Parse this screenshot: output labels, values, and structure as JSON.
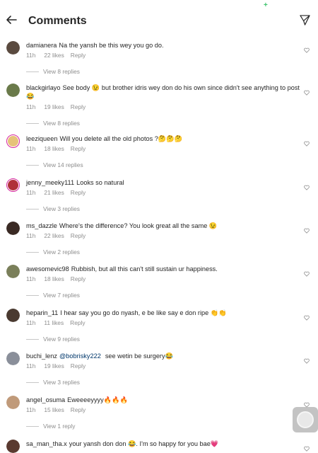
{
  "header": {
    "title": "Comments",
    "back_icon": "arrow-left-icon",
    "send_icon": "paper-plane-icon"
  },
  "status": {
    "plus_glyph": "+"
  },
  "reply_label": "Reply",
  "comments": [
    {
      "user": "damianera",
      "text": "Na the yansh be this wey you go do.",
      "mention": "",
      "time": "11h",
      "likes": "22 likes",
      "replies": "View 8 replies",
      "avatar_color": "#5a4a3f"
    },
    {
      "user": "blackgirlayo",
      "text": "See body 😉 but brother idris wey don do his own since didn't see anything to post 😂",
      "mention": "",
      "time": "11h",
      "likes": "19 likes",
      "replies": "View 8 replies",
      "avatar_color": "#6a7a4a"
    },
    {
      "user": "leeziqueen",
      "text": "Will you delete all the old photos ?🤔🤔🤔",
      "mention": "",
      "time": "11h",
      "likes": "18 likes",
      "replies": "View 14 replies",
      "avatar_color": "#e6c37a",
      "ring": true
    },
    {
      "user": "jenny_meeky111",
      "text": "Looks so natural",
      "mention": "",
      "time": "11h",
      "likes": "21 likes",
      "replies": "View 3 replies",
      "avatar_color": "#b0303a",
      "ring": true
    },
    {
      "user": "ms_dazzle",
      "text": "Where's the difference? You look great all the same 😉",
      "mention": "",
      "time": "11h",
      "likes": "22 likes",
      "replies": "View 2 replies",
      "avatar_color": "#3a2a24"
    },
    {
      "user": "awesomevic98",
      "text": "Rubbish, but all this can't still sustain ur happiness.",
      "mention": "",
      "time": "11h",
      "likes": "18 likes",
      "replies": "View 7 replies",
      "avatar_color": "#7a7f5a"
    },
    {
      "user": "heparin_11",
      "text": "I hear say you go do nyash, e be like say e don ripe 👏👏",
      "mention": "",
      "time": "11h",
      "likes": "11 likes",
      "replies": "View 9 replies",
      "avatar_color": "#4a3a30"
    },
    {
      "user": "buchi_lenz",
      "text": "see wetin be surgery😂",
      "mention": "@bobrisky222",
      "time": "11h",
      "likes": "19 likes",
      "replies": "View 3 replies",
      "avatar_color": "#8a8f9a"
    },
    {
      "user": "angel_osuma",
      "text": "Eweeeeyyyy🔥🔥🔥",
      "mention": "",
      "time": "11h",
      "likes": "15 likes",
      "replies": "View 1 reply",
      "avatar_color": "#c09a7a"
    },
    {
      "user": "sa_man_tha.x",
      "text": "your yansh don don 😂. I'm so happy for you bae💗",
      "mention": "",
      "time": "",
      "likes": "",
      "replies": "",
      "avatar_color": "#5a3a30"
    }
  ]
}
